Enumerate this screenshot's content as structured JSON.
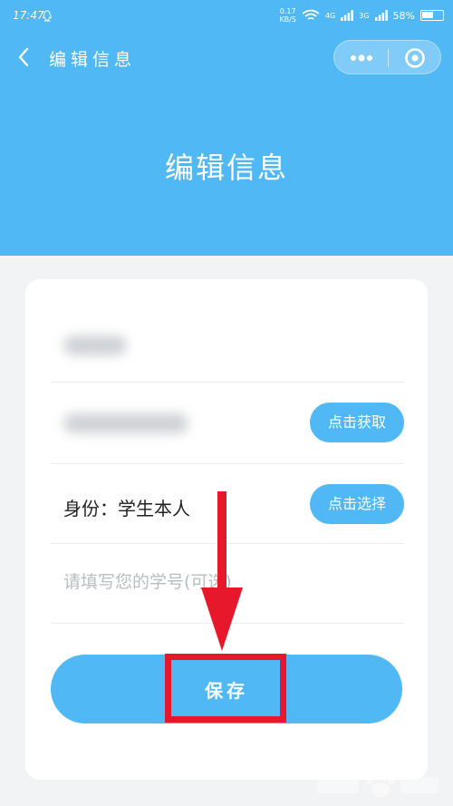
{
  "status_bar": {
    "time": "17:47",
    "speed_value": "0.17",
    "speed_unit": "KB/S",
    "network_1": "4G",
    "network_2": "3G",
    "battery": "58%"
  },
  "nav": {
    "title": "编辑信息",
    "icons": [
      "chevron-left-icon",
      "more-dots-icon",
      "target-close-icon"
    ]
  },
  "page": {
    "title": "编辑信息"
  },
  "form": {
    "phone_button": "点击获取",
    "identity_label": "身份：",
    "identity_value": "学生本人",
    "identity_button": "点击选择",
    "student_id_placeholder": "请填写您的学号(可选)",
    "save_button": "保存"
  },
  "colors": {
    "primary": "#4fb8f5",
    "annotation_red": "#e8182c",
    "background": "#f2f3f5"
  }
}
